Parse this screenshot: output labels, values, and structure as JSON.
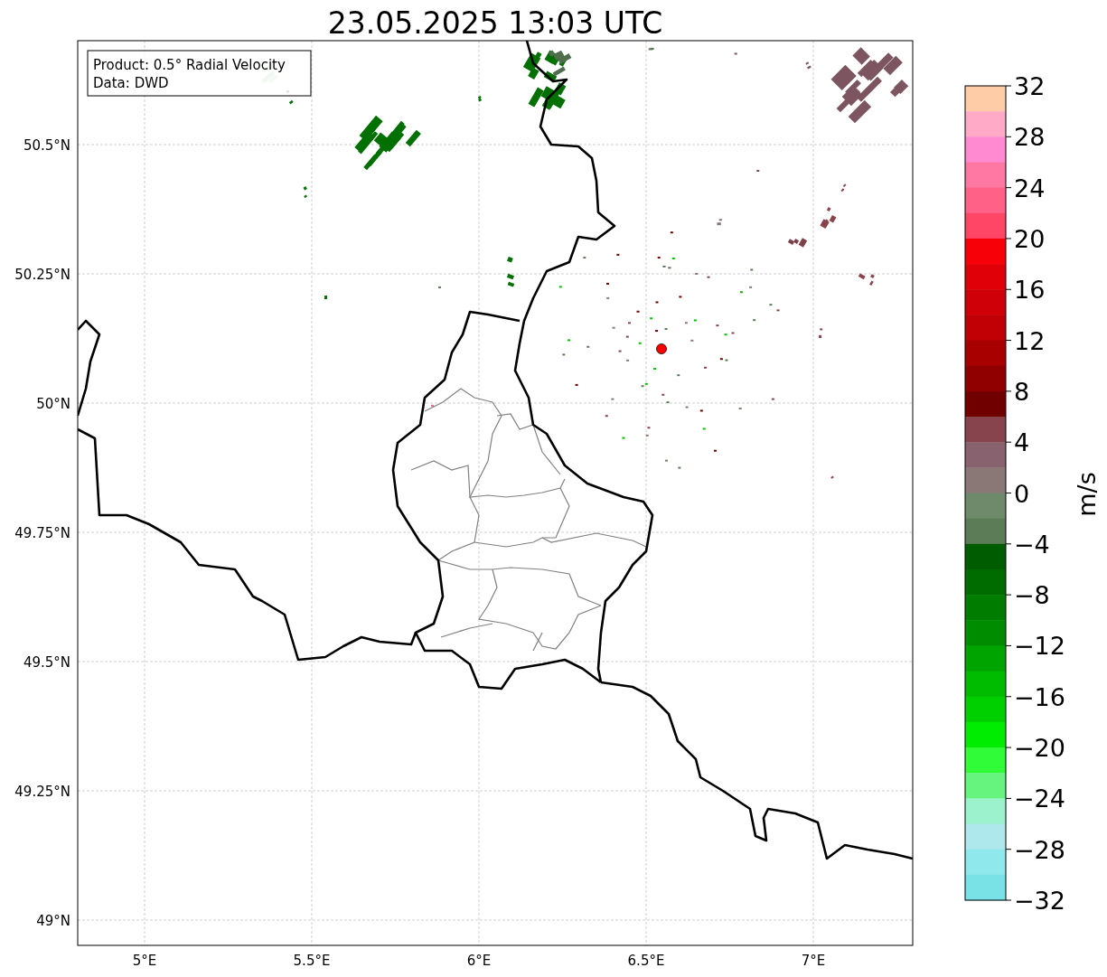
{
  "title": "23.05.2025 13:03 UTC",
  "legend": [
    "Product: 0.5° Radial Velocity",
    "Data: DWD"
  ],
  "x_ticks": [
    "5°E",
    "5.5°E",
    "6°E",
    "6.5°E",
    "7°E"
  ],
  "y_ticks": [
    "50.5°N",
    "50.25°N",
    "50°N",
    "49.75°N",
    "49.5°N",
    "49.25°N",
    "49°N"
  ],
  "colorbar": {
    "label": "m/s",
    "ticks": [
      "32",
      "28",
      "24",
      "20",
      "16",
      "12",
      "8",
      "4",
      "0",
      "−4",
      "−8",
      "−12",
      "−16",
      "−20",
      "−24",
      "−28",
      "−32"
    ],
    "segments": [
      {
        "color": "#ffcca8"
      },
      {
        "color": "#ffaac6"
      },
      {
        "color": "#ff8ad2"
      },
      {
        "color": "#ff78a4"
      },
      {
        "color": "#ff6286"
      },
      {
        "color": "#ff4666"
      },
      {
        "color": "#f80008"
      },
      {
        "color": "#e00008"
      },
      {
        "color": "#d00008"
      },
      {
        "color": "#c00004"
      },
      {
        "color": "#a80000"
      },
      {
        "color": "#900000"
      },
      {
        "color": "#700000"
      },
      {
        "color": "#88444c"
      },
      {
        "color": "#88626e"
      },
      {
        "color": "#8a7876"
      },
      {
        "color": "#6e8a6a"
      },
      {
        "color": "#5c7c58"
      },
      {
        "color": "#005c00"
      },
      {
        "color": "#006c00"
      },
      {
        "color": "#007c00"
      },
      {
        "color": "#008c00"
      },
      {
        "color": "#00a400"
      },
      {
        "color": "#00bc00"
      },
      {
        "color": "#00d000"
      },
      {
        "color": "#00ec00"
      },
      {
        "color": "#30fc38"
      },
      {
        "color": "#66f47e"
      },
      {
        "color": "#9cf2cc"
      },
      {
        "color": "#aee8ec"
      },
      {
        "color": "#8ee8ec"
      },
      {
        "color": "#78e2e6"
      }
    ]
  }
}
